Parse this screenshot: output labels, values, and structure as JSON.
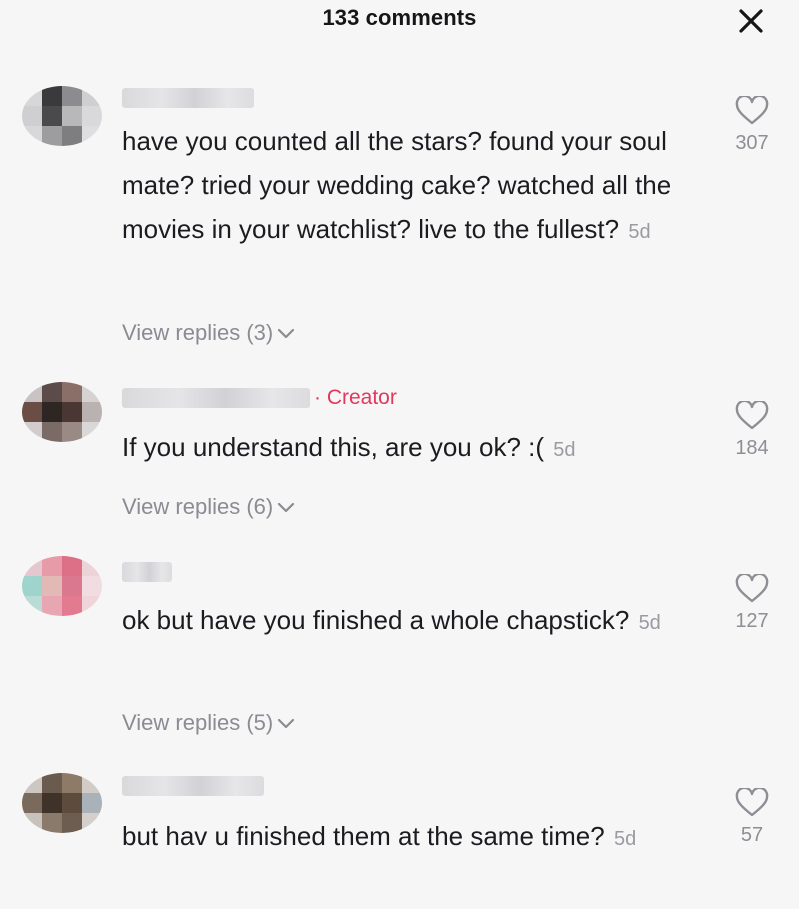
{
  "header": {
    "title": "133 comments",
    "close_icon": "close-icon"
  },
  "colors": {
    "background": "#f6f6f7",
    "text": "#1c1c20",
    "muted": "#8b8b92",
    "creator": "#e0395d"
  },
  "comments": [
    {
      "avatar_colors": [
        "#d7d7da",
        "#3a3a3c",
        "#8c8c90",
        "#cfcfd2",
        "#cfcfd2",
        "#4a4a4d",
        "#b8b8bb",
        "#d9d9dc",
        "#d8d8db",
        "#9d9da0",
        "#7e7e81",
        "#dedee1"
      ],
      "creator_label": "",
      "text": "have you counted all the stars? found your soul mate? tried your wedding cake? watched all the movies in your watchlist? live to the fullest?",
      "time": "5d",
      "replies": "View replies (3)",
      "likes": "307"
    },
    {
      "avatar_colors": [
        "#c9c3c3",
        "#5b4c4a",
        "#8a6f68",
        "#d6d2d2",
        "#6a4d45",
        "#2e2623",
        "#4a3633",
        "#b9b2b1",
        "#d2cccc",
        "#7b6b67",
        "#9a8a86",
        "#dad7d7"
      ],
      "creator_label": "· Creator",
      "text": "If you understand this, are you ok? :(",
      "time": "5d",
      "replies": "View replies (6)",
      "likes": "184"
    },
    {
      "avatar_colors": [
        "#e7c7cf",
        "#e79aa8",
        "#dd6f86",
        "#ecd3d8",
        "#9fd4cc",
        "#e3b9b5",
        "#d9788e",
        "#f1dde1",
        "#b9ddd6",
        "#e8a6b2",
        "#e27a90",
        "#efd5da"
      ],
      "creator_label": "",
      "text": "ok but have you finished a whole chapstick?",
      "time": "5d",
      "replies": "View replies (5)",
      "likes": "127"
    },
    {
      "avatar_colors": [
        "#cdc7c2",
        "#6a5b4e",
        "#8e7b67",
        "#d2ccc7",
        "#7a6a5c",
        "#3e3229",
        "#5d4c3c",
        "#a9b2b9",
        "#c8c2bd",
        "#8a7a6c",
        "#6c5d50",
        "#d4cfca"
      ],
      "creator_label": "",
      "text": "but hav u finished them at the same time?",
      "time": "5d",
      "replies": "",
      "likes": "57"
    }
  ]
}
